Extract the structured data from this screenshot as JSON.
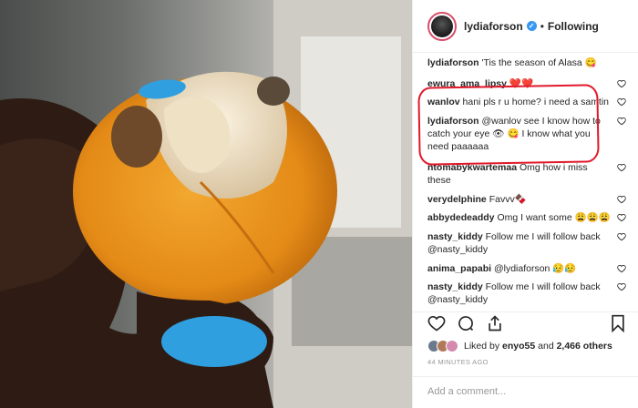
{
  "post": {
    "username": "lydiaforson",
    "verified_mark": "✓",
    "separator": "•",
    "follow_status": "Following"
  },
  "comments": [
    {
      "user": "lydiaforson",
      "text": "'Tis the season of Alasa 😋",
      "has_like": false
    },
    {
      "user": "ewura_ama_lipsy",
      "text": "❤️❤️",
      "has_like": true
    },
    {
      "user": "wanlov",
      "text": "hani pls r u home? i need a samtin",
      "has_like": true
    },
    {
      "user": "lydiaforson",
      "text": "@wanlov see I know how to catch your eye 👁 😋 I know what you need paaaaaa",
      "has_like": true
    },
    {
      "user": "ntomabykwartemaa",
      "text": "Omg how i miss these",
      "has_like": true
    },
    {
      "user": "verydelphine",
      "text": "Favvv🍫",
      "has_like": true
    },
    {
      "user": "abbydedeaddy",
      "text": "Omg I want some 😩😩😩",
      "has_like": true
    },
    {
      "user": "nasty_kiddy",
      "text": "Follow me I will follow back @nasty_kiddy",
      "has_like": true
    },
    {
      "user": "anima_papabi",
      "text": "@lydiaforson 😥😥",
      "has_like": true
    },
    {
      "user": "nasty_kiddy",
      "text": "Follow me I will follow back @nasty_kiddy",
      "has_like": true
    }
  ],
  "likes": {
    "text_prefix": "Liked by ",
    "liker": "enyo55",
    "text_mid": " and ",
    "count": "2,466 others"
  },
  "timestamp": "44 MINUTES AGO",
  "add_comment_placeholder": "Add a comment...",
  "icons": {
    "like": "heart-icon",
    "comment": "comment-icon",
    "share": "share-icon",
    "save": "bookmark-icon"
  },
  "colors": {
    "highlight_circle": "#e2182b",
    "verified": "#3897f0",
    "fruit": "#e8921c",
    "nail": "#2f9fe0"
  }
}
